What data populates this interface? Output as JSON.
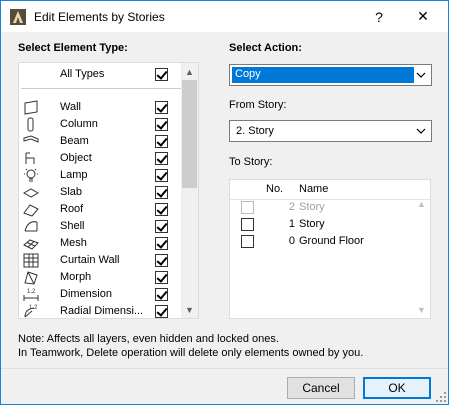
{
  "window": {
    "title": "Edit Elements by Stories",
    "help_glyph": "?",
    "close_glyph": "✕"
  },
  "element_type": {
    "heading": "Select Element Type:",
    "all_types": {
      "label": "All Types",
      "checked": true
    },
    "items": [
      {
        "label": "Wall",
        "icon": "wall-icon",
        "checked": true
      },
      {
        "label": "Column",
        "icon": "column-icon",
        "checked": true
      },
      {
        "label": "Beam",
        "icon": "beam-icon",
        "checked": true
      },
      {
        "label": "Object",
        "icon": "object-icon",
        "checked": true
      },
      {
        "label": "Lamp",
        "icon": "lamp-icon",
        "checked": true
      },
      {
        "label": "Slab",
        "icon": "slab-icon",
        "checked": true
      },
      {
        "label": "Roof",
        "icon": "roof-icon",
        "checked": true
      },
      {
        "label": "Shell",
        "icon": "shell-icon",
        "checked": true
      },
      {
        "label": "Mesh",
        "icon": "mesh-icon",
        "checked": true
      },
      {
        "label": "Curtain Wall",
        "icon": "curtain-wall-icon",
        "checked": true
      },
      {
        "label": "Morph",
        "icon": "morph-icon",
        "checked": true
      },
      {
        "label": "Dimension",
        "icon": "dimension-icon",
        "checked": true
      },
      {
        "label": "Radial Dimensi...",
        "icon": "radial-dimension-icon",
        "checked": true
      }
    ],
    "scroll_up": "▲",
    "scroll_down": "▼"
  },
  "action": {
    "heading": "Select Action:",
    "selected": "Copy",
    "dropdown_glyph": "⌄"
  },
  "from_story": {
    "label": "From Story:",
    "selected": "2. Story"
  },
  "to_story": {
    "label": "To Story:",
    "columns": [
      "No.",
      "Name"
    ],
    "rows": [
      {
        "no": "2",
        "name": "Story",
        "checked": false,
        "disabled": true
      },
      {
        "no": "1",
        "name": "Story",
        "checked": false,
        "disabled": false
      },
      {
        "no": "0",
        "name": "Ground Floor",
        "checked": false,
        "disabled": false
      }
    ]
  },
  "notes": [
    "Note: Affects all layers, even hidden and locked ones.",
    "In Teamwork, Delete operation will delete only elements owned by you."
  ],
  "buttons": {
    "cancel": "Cancel",
    "ok": "OK"
  },
  "colors": {
    "accent": "#0078d7",
    "window_border": "#1883d7"
  }
}
